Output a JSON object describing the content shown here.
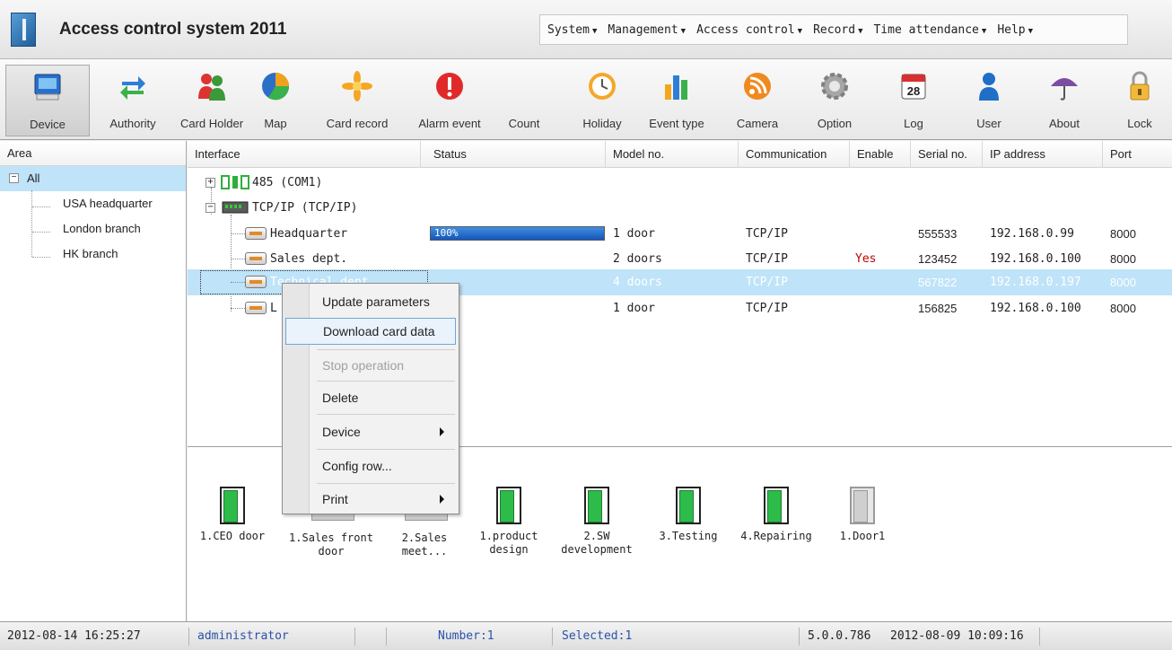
{
  "app": {
    "title": "Access control system 2011"
  },
  "menu": [
    "System",
    "Management",
    "Access control",
    "Record",
    "Time attendance",
    "Help"
  ],
  "toolbar": [
    {
      "label": "Device",
      "icon": "device-icon"
    },
    {
      "label": "Authority",
      "icon": "authority-icon"
    },
    {
      "label": "Card Holder",
      "icon": "card-holder-icon"
    },
    {
      "label": "Map",
      "icon": "map-icon"
    },
    {
      "label": "Card record",
      "icon": "card-record-icon"
    },
    {
      "label": "Alarm event",
      "icon": "alarm-event-icon"
    },
    {
      "label": "Count",
      "icon": "count-icon"
    },
    {
      "label": "Holiday",
      "icon": "holiday-icon"
    },
    {
      "label": "Event type",
      "icon": "event-type-icon"
    },
    {
      "label": "Camera",
      "icon": "camera-icon"
    },
    {
      "label": "Option",
      "icon": "option-icon"
    },
    {
      "label": "Log",
      "icon": "log-icon",
      "badge": "28"
    },
    {
      "label": "User",
      "icon": "user-icon"
    },
    {
      "label": "About",
      "icon": "about-icon"
    },
    {
      "label": "Lock",
      "icon": "lock-icon"
    }
  ],
  "area": {
    "header": "Area",
    "expander": "−",
    "root": "All",
    "items": [
      "USA headquarter",
      "London branch",
      "HK branch"
    ]
  },
  "grid": {
    "columns": [
      "Interface",
      "Status",
      "Model no.",
      "Communication",
      "Enable",
      "Serial no.",
      "IP address",
      "Port"
    ],
    "nodes": [
      {
        "label": "485 (COM1)",
        "expander": "+"
      },
      {
        "label": "TCP/IP (TCP/IP)",
        "expander": "−"
      }
    ],
    "rows": [
      {
        "interface": "Headquarter",
        "status": "100%",
        "progress": 1.0,
        "model": "1 door",
        "comm": "TCP/IP",
        "enable": "",
        "serial": "555533",
        "ip": "192.168.0.99",
        "port": "8000"
      },
      {
        "interface": "Sales dept.",
        "status": "",
        "model": "2 doors",
        "comm": "TCP/IP",
        "enable": "Yes",
        "serial": "123452",
        "ip": "192.168.0.100",
        "port": "8000"
      },
      {
        "interface": "Technical dept.",
        "status": "",
        "model": "4 doors",
        "comm": "TCP/IP",
        "enable": "",
        "serial": "567822",
        "ip": "192.168.0.197",
        "port": "8000"
      },
      {
        "interface": "L",
        "status": "",
        "model": "1 door",
        "comm": "TCP/IP",
        "enable": "",
        "serial": "156825",
        "ip": "192.168.0.100",
        "port": "8000"
      }
    ]
  },
  "doors": [
    {
      "label": "1.CEO door",
      "state": "open"
    },
    {
      "label": "1.Sales front door",
      "state": "open"
    },
    {
      "label": "2.Sales meet...",
      "state": "open"
    },
    {
      "label": "1.product design",
      "state": "open"
    },
    {
      "label": "2.SW development",
      "state": "open"
    },
    {
      "label": "3.Testing",
      "state": "open"
    },
    {
      "label": "4.Repairing",
      "state": "open"
    },
    {
      "label": "1.Door1",
      "state": "offline"
    }
  ],
  "context_menu": {
    "items": [
      {
        "label": "Update parameters"
      },
      {
        "label": "Download card data",
        "hover": true
      },
      {
        "label": "Stop operation",
        "disabled": true
      },
      {
        "label": "Delete"
      },
      {
        "label": "Device",
        "submenu": true
      },
      {
        "label": "Config row..."
      },
      {
        "label": "Print",
        "submenu": true
      }
    ]
  },
  "status": {
    "datetime": "2012-08-14 16:25:27",
    "user": "administrator",
    "number": "Number:1",
    "selected": "Selected:1",
    "version": "5.0.0.786",
    "build_date": "2012-08-09 10:09:16"
  },
  "colors": {
    "accent": "#bfe3f9",
    "enable_yes": "#c00000",
    "door_open": "#2dbb4a"
  }
}
